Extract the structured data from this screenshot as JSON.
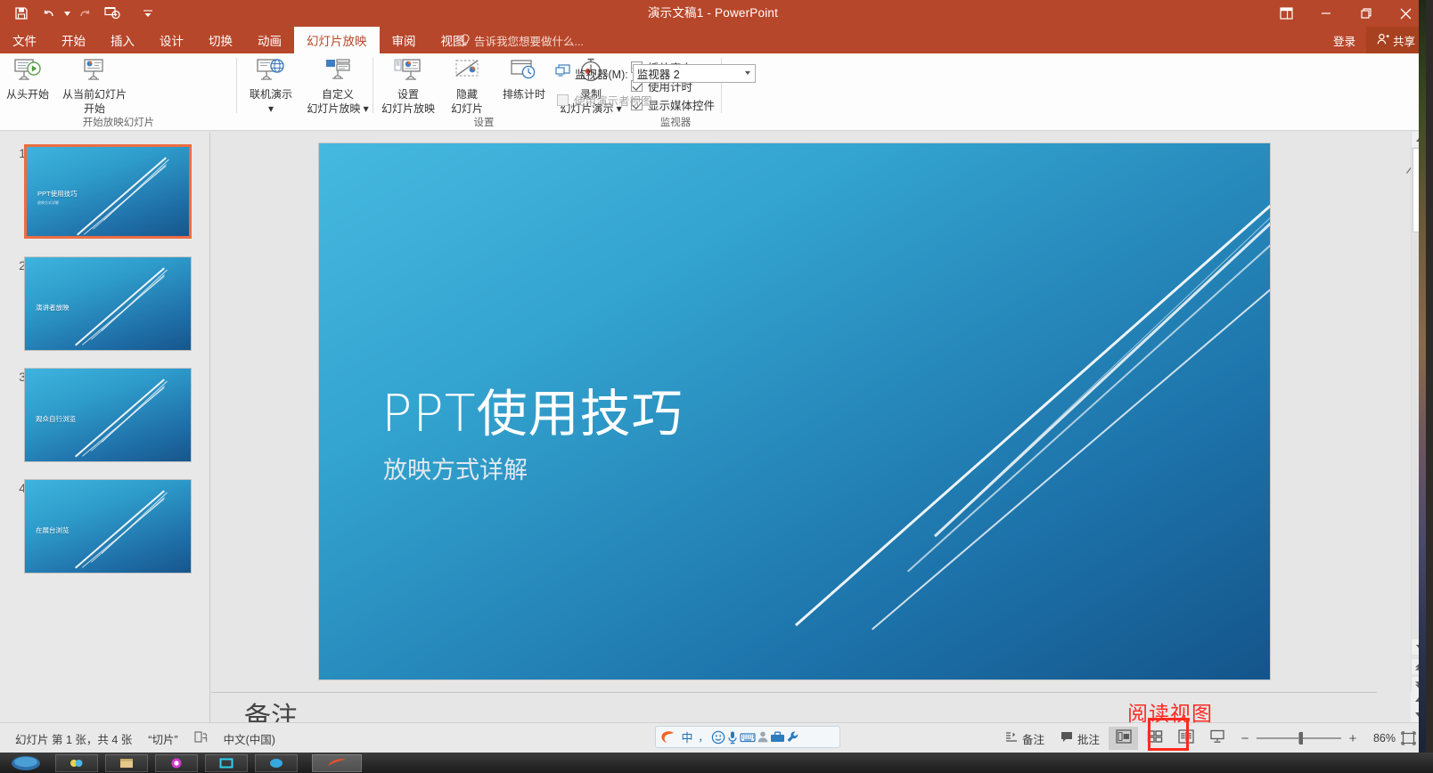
{
  "window": {
    "title": "演示文稿1 - PowerPoint",
    "quick_access": [
      "save-icon",
      "undo-icon",
      "redo-icon",
      "start-slideshow-icon",
      "customize-qat-icon"
    ],
    "ribbon_display_options": "ribbon-display-options-icon",
    "minimize": "minimize-icon",
    "restore": "restore-icon",
    "close": "close-icon"
  },
  "tabs": [
    {
      "label": "文件",
      "active": false
    },
    {
      "label": "开始",
      "active": false
    },
    {
      "label": "插入",
      "active": false
    },
    {
      "label": "设计",
      "active": false
    },
    {
      "label": "切换",
      "active": false
    },
    {
      "label": "动画",
      "active": false
    },
    {
      "label": "幻灯片放映",
      "active": true
    },
    {
      "label": "审阅",
      "active": false
    },
    {
      "label": "视图",
      "active": false
    }
  ],
  "tell_me": "告诉我您想要做什么...",
  "account": {
    "sign_in": "登录",
    "share": "共享"
  },
  "ribbon": {
    "groups": [
      {
        "name": "开始放映幻灯片",
        "buttons": [
          {
            "label_line1": "从头开始",
            "label_line2": "",
            "icon": "start-from-beginning-icon"
          },
          {
            "label_line1": "从当前幻灯片",
            "label_line2": "开始",
            "icon": "start-from-current-icon"
          }
        ]
      },
      {
        "name": "",
        "buttons": [
          {
            "label_line1": "联机演示",
            "label_line2": "▾",
            "icon": "present-online-icon"
          },
          {
            "label_line1": "自定义",
            "label_line2": "幻灯片放映 ▾",
            "icon": "custom-slideshow-icon"
          }
        ]
      },
      {
        "name": "设置",
        "buttons": [
          {
            "label_line1": "设置",
            "label_line2": "幻灯片放映",
            "icon": "setup-slideshow-icon"
          },
          {
            "label_line1": "隐藏",
            "label_line2": "幻灯片",
            "icon": "hide-slide-icon"
          },
          {
            "label_line1": "排练计时",
            "label_line2": "",
            "icon": "rehearse-timings-icon"
          },
          {
            "label_line1": "录制",
            "label_line2": "幻灯片演示 ▾",
            "icon": "record-slideshow-icon"
          }
        ],
        "checkboxes": [
          {
            "label": "播放旁白",
            "checked": true,
            "disabled": false
          },
          {
            "label": "使用计时",
            "checked": true,
            "disabled": false
          },
          {
            "label": "显示媒体控件",
            "checked": true,
            "disabled": false
          }
        ]
      },
      {
        "name": "监视器",
        "monitor_label": "监视器(M):",
        "monitor_value": "监视器 2",
        "monitor_icon": "monitor-icon",
        "presenter_view": {
          "label": "使用演示者视图",
          "checked": false,
          "disabled": true
        }
      }
    ],
    "collapse_icon": "collapse-ribbon-icon"
  },
  "thumbnails": [
    {
      "number": "1",
      "title": "PPT使用技巧",
      "subtitle": "放映方式详解",
      "selected": true
    },
    {
      "number": "2",
      "title": "演讲者放映",
      "subtitle": "",
      "selected": false
    },
    {
      "number": "3",
      "title": "观众自行浏览",
      "subtitle": "",
      "selected": false
    },
    {
      "number": "4",
      "title": "在展台浏览",
      "subtitle": "",
      "selected": false
    }
  ],
  "slide": {
    "title": "PPT使用技巧",
    "subtitle": "放映方式详解"
  },
  "notes": {
    "text": "备注"
  },
  "statusbar": {
    "slide_count": "幻灯片 第 1 张，共 4 张",
    "theme": "“切片”",
    "accessibility_icon": "accessibility-check-icon",
    "language": "中文(中国)",
    "notes_button": "备注",
    "comments_button": "批注",
    "views": [
      {
        "name": "normal-view",
        "icon": "normal-view-icon",
        "active": true
      },
      {
        "name": "slide-sorter-view",
        "icon": "slide-sorter-icon",
        "active": false
      },
      {
        "name": "reading-view",
        "icon": "reading-view-icon",
        "active": false
      },
      {
        "name": "slideshow-view",
        "icon": "slideshow-icon",
        "active": false
      }
    ],
    "zoom_out": "−",
    "zoom_in": "+",
    "zoom_level": "86%",
    "fit_to_window": "fit-slide-icon"
  },
  "annotation": {
    "label": "阅读视图",
    "color": "#ff2a21"
  },
  "ime": {
    "items": [
      "sogou-logo-icon",
      "chinese-mode-icon",
      "punctuation-icon",
      "emoji-icon",
      "voice-input-icon",
      "soft-keyboard-icon",
      "user-icon",
      "toolbox-icon",
      "settings-wrench-icon"
    ]
  },
  "colors": {
    "accent": "#b7472a",
    "share_bg": "#a8411f",
    "selection": "#ed6c43",
    "annotation": "#ff2a21"
  }
}
